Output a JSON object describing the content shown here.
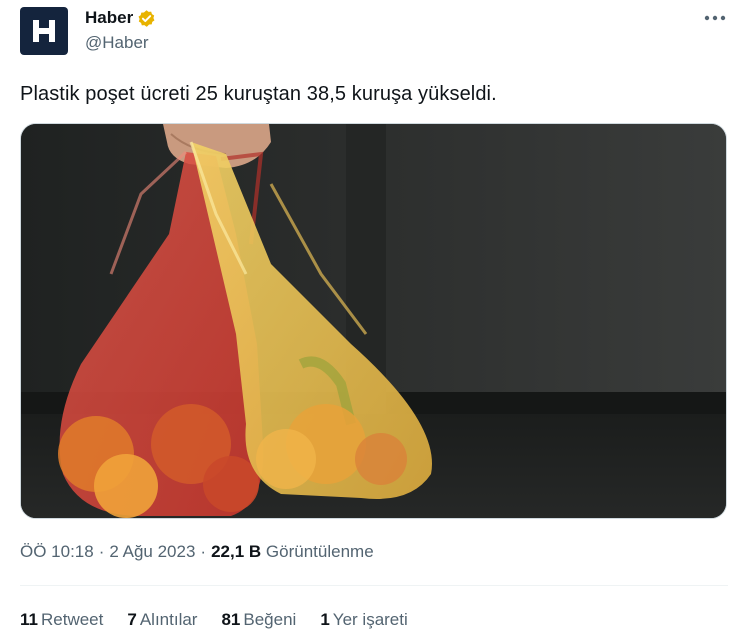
{
  "account": {
    "display_name": "Haber",
    "handle": "@Haber",
    "avatar_letter": "H",
    "verified_color": "#e8b300"
  },
  "tweet": {
    "text": "Plastik poşet ücreti 25 kuruştan 38,5 kuruşa yükseldi.",
    "time": "ÖÖ 10:18",
    "date": "2 Ağu 2023",
    "views_count": "22,1 B",
    "views_label": "Görüntülenme"
  },
  "stats": {
    "retweets_count": "11",
    "retweets_label": "Retweet",
    "quotes_count": "7",
    "quotes_label": "Alıntılar",
    "likes_count": "81",
    "likes_label": "Beğeni",
    "bookmarks_count": "1",
    "bookmarks_label": "Yer işareti"
  },
  "icons": {
    "more": "more-horizontal-icon",
    "verified": "verified-badge-icon"
  },
  "colors": {
    "text_primary": "#0f1419",
    "text_secondary": "#536471",
    "avatar_bg": "#14243d",
    "divider": "#eff3f4"
  }
}
